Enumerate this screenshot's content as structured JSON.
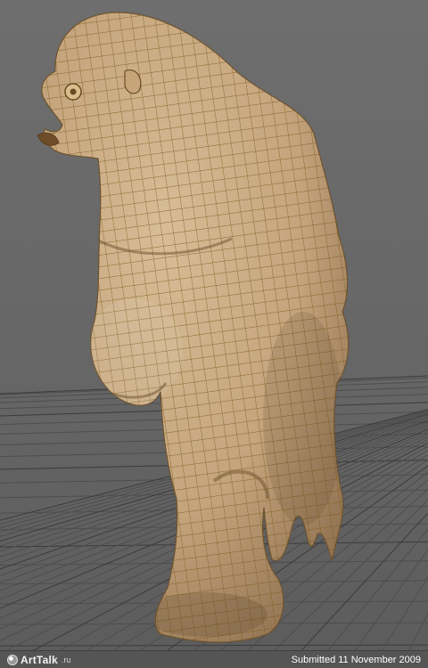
{
  "footer": {
    "logo_text": "ArtTalk",
    "logo_tld": ".ru",
    "submitted": "Submitted 11 November 2009"
  },
  "scene": {
    "subject": "sculpted-creature-wireframe",
    "colors": {
      "skin": "#c9ab85",
      "wire": "#7a5a1a",
      "shadow": "#8b6d4a",
      "grid_line": "#4e4e4e",
      "grid_major": "#3b3b3b"
    }
  }
}
